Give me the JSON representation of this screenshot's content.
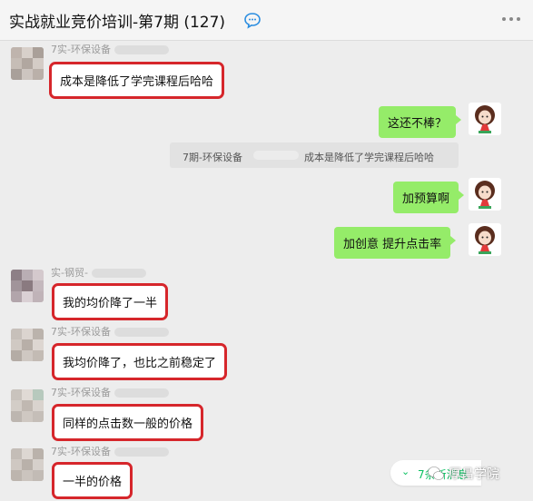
{
  "header": {
    "title": "实战就业竞价培训-第7期 (127)",
    "chat_icon": "chat-bubble-icon",
    "more_icon": "more-dots-icon"
  },
  "messages": [
    {
      "side": "left",
      "sender": "7实-环保设备",
      "text": "成本是降低了学完课程后哈哈"
    },
    {
      "side": "right",
      "text": "这还不棒？"
    },
    {
      "side": "quote",
      "quote_sender": "7期-环保设备",
      "quote_text": "成本是降低了学完课程后哈哈"
    },
    {
      "side": "right",
      "text": "加预算啊"
    },
    {
      "side": "right",
      "text": "加创意  提升点击率"
    },
    {
      "side": "left",
      "sender": "实-钢贸-",
      "text": "我的均价降了一半"
    },
    {
      "side": "left",
      "sender": "7实-环保设备",
      "text": "我均价降了，也比之前稳定了"
    },
    {
      "side": "left",
      "sender": "7实-环保设备",
      "text": "同样的点击数一般的价格"
    },
    {
      "side": "left",
      "sender": "7实-环保设备",
      "text": "一半的价格"
    }
  ],
  "new_messages_label": "7条新消息",
  "watermark": {
    "text": "厚昌学院",
    "logo_icon": "wechat-logo-icon"
  },
  "colors": {
    "highlight": "#d6262b",
    "bubble_right": "#95ec69",
    "accent": "#07c160"
  }
}
